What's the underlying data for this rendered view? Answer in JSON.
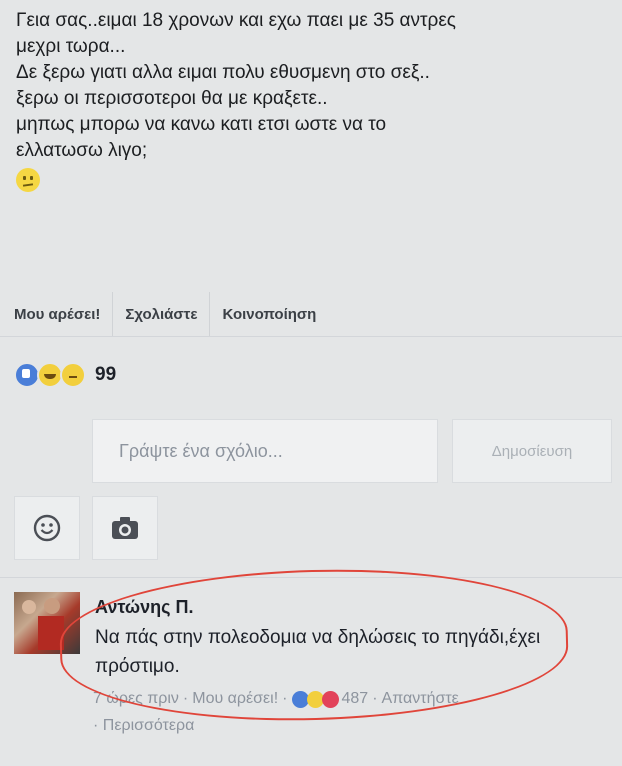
{
  "post": {
    "lines": [
      "Γεια σας..ειμαι 18 χρονων και εχω παει με 35 αντρες",
      "μεχρι τωρα...",
      "Δε ξερω γιατι αλλα ειμαι πολυ εθυσμενη στο σεξ..",
      "ξερω οι περισσοτεροι θα με κραξετε..",
      "μηπως μπορω να κανω κατι ετσι ωστε να το",
      "ελλατωσω λιγο;"
    ],
    "emoji_icon": "confused-face-icon"
  },
  "actions": {
    "like": "Μου αρέσει!",
    "comment": "Σχολιάστε",
    "share": "Κοινοποίηση"
  },
  "reactions": {
    "icons": [
      "like-icon",
      "haha-icon",
      "sad-icon"
    ],
    "count": "99"
  },
  "composer": {
    "placeholder": "Γράψτε ένα σχόλιο...",
    "publish_label": "Δημοσίευση",
    "emoji_icon": "smiley-icon",
    "camera_icon": "camera-icon"
  },
  "comment": {
    "author": "Αντώνης Π.",
    "text": "Να πάς στην πολεοδομια να δηλώσεις το πηγάδι,έχει πρόστιμο.",
    "time": "7 ώρες πριν",
    "like_label": "Μου αρέσει!",
    "reaction_count": "487",
    "reply_label": "Απαντήστε",
    "more_label": "Περισσότερα",
    "separator": "·"
  },
  "colors": {
    "background": "#e4e6e7",
    "annotation_oval": "#e0453a",
    "like_blue": "#4a7ed8"
  }
}
